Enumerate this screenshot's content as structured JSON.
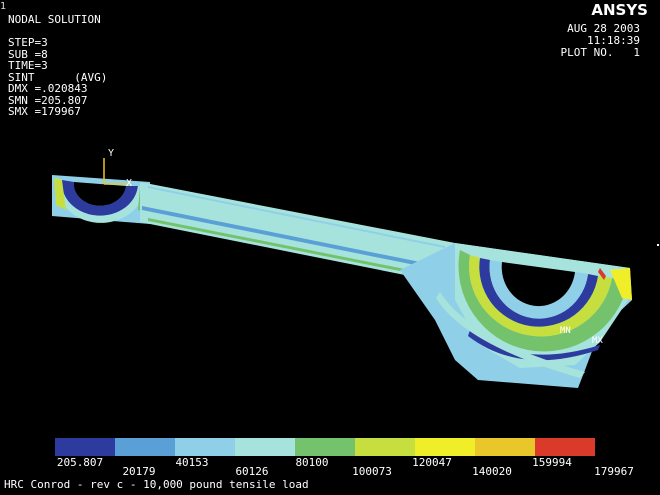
{
  "window_number": "1",
  "info_lines": [
    "NODAL SOLUTION",
    "",
    "STEP=3",
    "SUB =8",
    "TIME=3",
    "SINT      (AVG)",
    "DMX =.020843",
    "SMN =205.807",
    "SMX =179967"
  ],
  "logo": "ANSYS",
  "date_lines": [
    "AUG 28 2003",
    "11:18:39",
    "PLOT NO.   1"
  ],
  "axis": {
    "y": "Y",
    "x": "X"
  },
  "markers": {
    "mn": "MN",
    "mx": "MX"
  },
  "legend": {
    "colors": [
      "#2d3a9e",
      "#5a9fd6",
      "#8fd0e8",
      "#a6e3dc",
      "#74c36c",
      "#c6df3f",
      "#f0ee28",
      "#e9c72a",
      "#d93a2a"
    ],
    "labels_top": [
      "205.807",
      "40153",
      "80100",
      "120047",
      "159994"
    ],
    "labels_bottom": [
      "20179",
      "60126",
      "100073",
      "140020",
      "179967"
    ]
  },
  "caption": "HRC Conrod - rev c - 10,000 pound tensile load"
}
